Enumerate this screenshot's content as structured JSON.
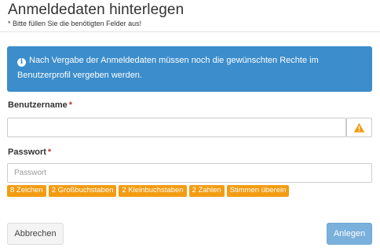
{
  "dialog": {
    "title": "Anmeldedaten hinterlegen",
    "subtitle": "* Bitte füllen Sie die benötigten Felder aus!"
  },
  "info": {
    "icon": "info-icon",
    "text": "Nach Vergabe der Anmeldedaten müssen noch die gewünschten Rechte im Benutzerprofil vergeben werden."
  },
  "username": {
    "label": "Benutzername",
    "required_mark": "*",
    "value": "",
    "status_icon": "warning-icon"
  },
  "password": {
    "label": "Passwort",
    "required_mark": "*",
    "value": "",
    "placeholder": "Passwort",
    "requirements": [
      "8 Zeichen",
      "2 Großbuchstaben",
      "2 Kleinbuchstaben",
      "2 Zahlen",
      "Stimmen überein"
    ]
  },
  "buttons": {
    "cancel": "Abbrechen",
    "submit": "Anlegen"
  },
  "colors": {
    "info_background": "#3c8dcb",
    "warning": "#f39c12",
    "requirement_badge": "#f39c12",
    "submit_button": "#7ab0dc"
  }
}
